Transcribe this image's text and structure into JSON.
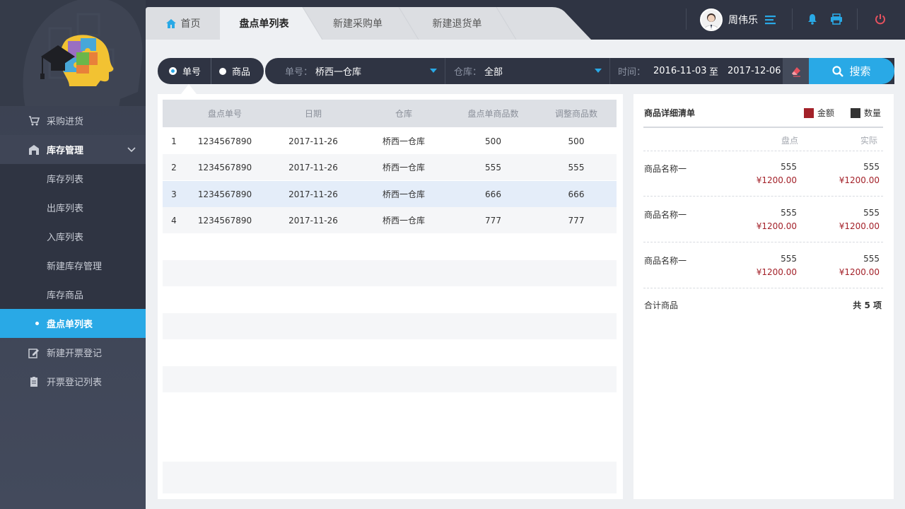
{
  "sidebar": {
    "menu": [
      {
        "label": "采购进货",
        "icon": "cart-icon"
      },
      {
        "label": "库存管理",
        "icon": "warehouse-icon"
      }
    ],
    "submenu": [
      {
        "label": "库存列表"
      },
      {
        "label": "出库列表"
      },
      {
        "label": "入库列表"
      },
      {
        "label": "新建库存管理"
      },
      {
        "label": "库存商品"
      },
      {
        "label": "盘点单列表"
      }
    ],
    "menu_bottom": [
      {
        "label": "新建开票登记",
        "icon": "edit-icon"
      },
      {
        "label": "开票登记列表",
        "icon": "clipboard-icon"
      }
    ],
    "active_color": "#29a9e6"
  },
  "tabs": [
    {
      "label": "首页",
      "icon": "home-icon"
    },
    {
      "label": "盘点单列表"
    },
    {
      "label": "新建采购单"
    },
    {
      "label": "新建退货单"
    }
  ],
  "user": {
    "name": "周伟乐"
  },
  "search": {
    "radio": [
      {
        "label": "单号",
        "selected": true
      },
      {
        "label": "商品",
        "selected": false
      }
    ],
    "order_label": "单号：",
    "order_value": "桥西一仓库",
    "warehouse_label": "仓库：",
    "warehouse_value": "全部",
    "time_label": "时间：",
    "date_from": "2016-11-03",
    "date_sep": "至",
    "date_to": "2017-12-06",
    "button_label": "搜索"
  },
  "table": {
    "headers": [
      "盘点单号",
      "日期",
      "仓库",
      "盘点单商品数",
      "调整商品数"
    ],
    "rows": [
      {
        "idx": "1",
        "no": "1234567890",
        "date": "2017-11-26",
        "warehouse": "桥西一仓库",
        "count": "500",
        "adjust": "500"
      },
      {
        "idx": "2",
        "no": "1234567890",
        "date": "2017-11-26",
        "warehouse": "桥西一仓库",
        "count": "555",
        "adjust": "555"
      },
      {
        "idx": "3",
        "no": "1234567890",
        "date": "2017-11-26",
        "warehouse": "桥西一仓库",
        "count": "666",
        "adjust": "666"
      },
      {
        "idx": "4",
        "no": "1234567890",
        "date": "2017-11-26",
        "warehouse": "桥西一仓库",
        "count": "777",
        "adjust": "777"
      }
    ]
  },
  "detail": {
    "title": "商品详细清单",
    "legend": [
      {
        "label": "金额",
        "color": "#a32129"
      },
      {
        "label": "数量",
        "color": "#333333"
      }
    ],
    "col_check": "盘点",
    "col_actual": "实际",
    "items": [
      {
        "name": "商品名称一",
        "check_qty": "555",
        "check_amt": "¥1200.00",
        "actual_qty": "555",
        "actual_amt": "¥1200.00"
      },
      {
        "name": "商品名称一",
        "check_qty": "555",
        "check_amt": "¥1200.00",
        "actual_qty": "555",
        "actual_amt": "¥1200.00"
      },
      {
        "name": "商品名称一",
        "check_qty": "555",
        "check_amt": "¥1200.00",
        "actual_qty": "555",
        "actual_amt": "¥1200.00"
      }
    ],
    "total_label": "合计商品",
    "total_value": "共 5 项"
  }
}
